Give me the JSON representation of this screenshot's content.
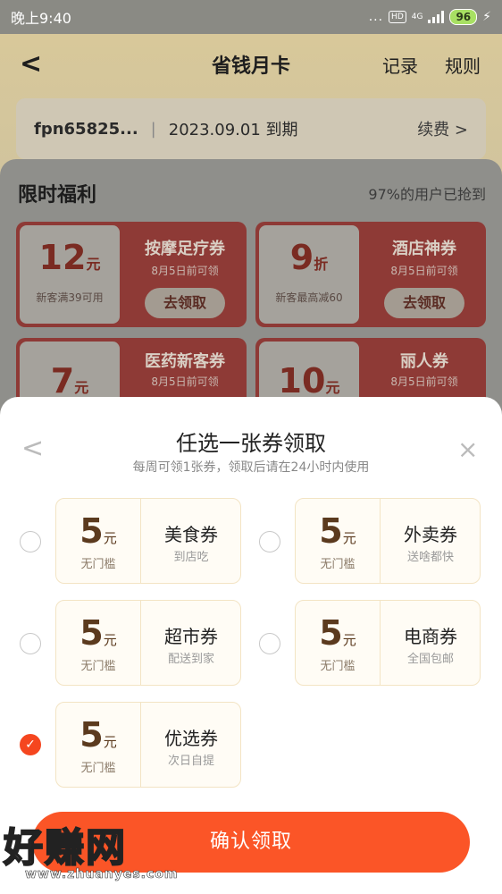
{
  "status_bar": {
    "time": "晚上9:40",
    "dots": "...",
    "hd": "HD",
    "network": "4G",
    "battery": "96",
    "charging": "⚡"
  },
  "navbar": {
    "back": "<",
    "title": "省钱月卡",
    "record": "记录",
    "rules": "规则"
  },
  "card_info": {
    "account": "fpn65825...",
    "separator": "|",
    "expiry": "2023.09.01 到期",
    "renew": "续费 >"
  },
  "welfare": {
    "title": "限时福利",
    "subtitle": "97%的用户已抢到",
    "cards": [
      {
        "num": "12",
        "unit": "元",
        "condition": "新客满39可用",
        "name": "按摩足疗券",
        "deadline": "8月5日前可领",
        "button": "去领取"
      },
      {
        "num": "9",
        "unit": "折",
        "condition": "新客最高减60",
        "name": "酒店神券",
        "deadline": "8月5日前可领",
        "button": "去领取"
      },
      {
        "num": "7",
        "unit": "元",
        "condition": "",
        "name": "医药新客券",
        "deadline": "8月5日前可领",
        "button": ""
      },
      {
        "num": "10",
        "unit": "元",
        "condition": "",
        "name": "丽人券",
        "deadline": "8月5日前可领",
        "button": ""
      }
    ]
  },
  "sheet": {
    "back": "<",
    "close": "×",
    "title": "任选一张券领取",
    "subtitle": "每周可领1张券，领取后请在24小时内使用",
    "coupons": [
      {
        "amount": "5",
        "unit": "元",
        "threshold": "无门槛",
        "name": "美食券",
        "desc": "到店吃",
        "selected": false
      },
      {
        "amount": "5",
        "unit": "元",
        "threshold": "无门槛",
        "name": "外卖券",
        "desc": "送啥都快",
        "selected": false
      },
      {
        "amount": "5",
        "unit": "元",
        "threshold": "无门槛",
        "name": "超市券",
        "desc": "配送到家",
        "selected": false
      },
      {
        "amount": "5",
        "unit": "元",
        "threshold": "无门槛",
        "name": "电商券",
        "desc": "全国包邮",
        "selected": false
      },
      {
        "amount": "5",
        "unit": "元",
        "threshold": "无门槛",
        "name": "优选券",
        "desc": "次日自提",
        "selected": true
      }
    ],
    "check_mark": "✓",
    "confirm": "确认领取"
  },
  "watermark": {
    "text": "好赚网",
    "url": "www.zhuanyes.com"
  },
  "colors": {
    "accent": "#fb5527",
    "checked": "#f5461f",
    "coupon_border": "#f3e4c4"
  }
}
